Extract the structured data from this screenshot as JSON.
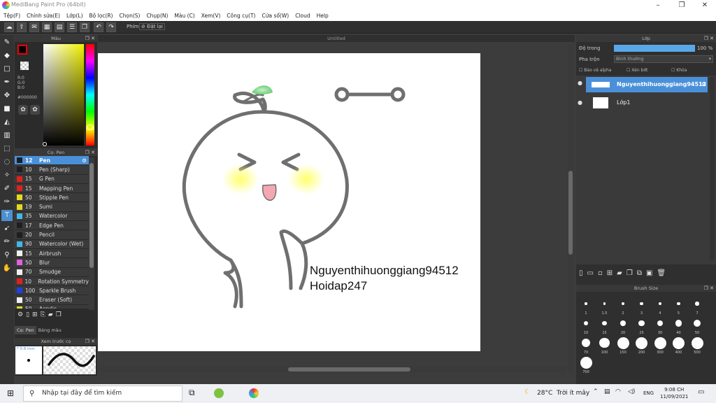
{
  "window": {
    "title": "MediBang Paint Pro (64bit)",
    "minimize": "–",
    "maximize": "❐",
    "close": "✕"
  },
  "menu": [
    "Tệp(F)",
    "Chỉnh sửa(E)",
    "Lớp(L)",
    "Bộ lọc(R)",
    "Chọn(S)",
    "Chụp(N)",
    "Màu (C)",
    "Xem(V)",
    "Công cụ(T)",
    "Cửa sổ(W)",
    "Cloud",
    "Help"
  ],
  "toolbar": {
    "phim_label": "Phím",
    "reset_label": "Đặt lại"
  },
  "color_panel": {
    "title": "Màu",
    "rgb": [
      "R:0",
      "G:0",
      "B:0"
    ],
    "hex": "#000000"
  },
  "pen_panel": {
    "title": "Cọ: Pen",
    "items": [
      {
        "size": "12",
        "name": "Pen",
        "color": "#1e1e1e",
        "selected": true
      },
      {
        "size": "10",
        "name": "Pen (Sharp)",
        "color": "#1e1e1e"
      },
      {
        "size": "15",
        "name": "G Pen",
        "color": "#e02020"
      },
      {
        "size": "15",
        "name": "Mapping Pen",
        "color": "#e02020"
      },
      {
        "size": "50",
        "name": "Stipple Pen",
        "color": "#e8d820"
      },
      {
        "size": "19",
        "name": "Sumi",
        "color": "#e8d820"
      },
      {
        "size": "35",
        "name": "Watercolor",
        "color": "#40b8e8"
      },
      {
        "size": "17",
        "name": "Edge Pen",
        "color": "#1e1e1e"
      },
      {
        "size": "20",
        "name": "Pencil",
        "color": "#1e1e1e"
      },
      {
        "size": "90",
        "name": "Watercolor (Wet)",
        "color": "#40b8e8"
      },
      {
        "size": "15",
        "name": "Airbrush",
        "color": "#f0f0f0"
      },
      {
        "size": "50",
        "name": "Blur",
        "color": "#e060e0"
      },
      {
        "size": "70",
        "name": "Smudge",
        "color": "#f0f0f0"
      },
      {
        "size": "10",
        "name": "Rotation Symmetry",
        "color": "#e02020"
      },
      {
        "size": "100",
        "name": "Sparkle Brush",
        "color": "#2040e0"
      },
      {
        "size": "50",
        "name": "Eraser (Soft)",
        "color": "#f0f0f0"
      },
      {
        "size": "50",
        "name": "Acrylic",
        "color": "#e8d820"
      }
    ],
    "tabs": [
      "Cọ: Pen",
      "Bảng màu"
    ]
  },
  "preview_panel": {
    "title": "Xem trước cọ",
    "size": "* 0.8 mm"
  },
  "document": {
    "tab": "Untitled"
  },
  "canvas_text": {
    "line1": "Nguyenthihuonggiang94512",
    "line2": "Hoidap247"
  },
  "layer_panel": {
    "title": "Lớp",
    "opacity_label": "Độ trong",
    "opacity_value": "100 %",
    "opacity_fraction": 1.0,
    "blend_label": "Pha trộn",
    "blend_value": "Bình thường",
    "protect_alpha": "Bảo vệ alpha",
    "clipping": "Xén bớt",
    "lock": "Khóa",
    "layers": [
      {
        "name": "Nguyenthihuonggiang94512",
        "selected": true
      },
      {
        "name": "Lớp1",
        "selected": false
      }
    ]
  },
  "brush_size_panel": {
    "title": "Brush Size",
    "sizes": [
      "1",
      "1.5",
      "2",
      "3",
      "4",
      "5",
      "7",
      "10",
      "15",
      "20",
      "25",
      "30",
      "40",
      "50",
      "70",
      "100",
      "150",
      "200",
      "300",
      "400",
      "500",
      "700"
    ]
  },
  "taskbar": {
    "search_placeholder": "Nhập tại đây để tìm kiếm",
    "weather_temp": "28°C",
    "weather_desc": "Trời ít mây",
    "lang": "ENG",
    "time": "9:08 CH",
    "date": "11/09/2021"
  }
}
